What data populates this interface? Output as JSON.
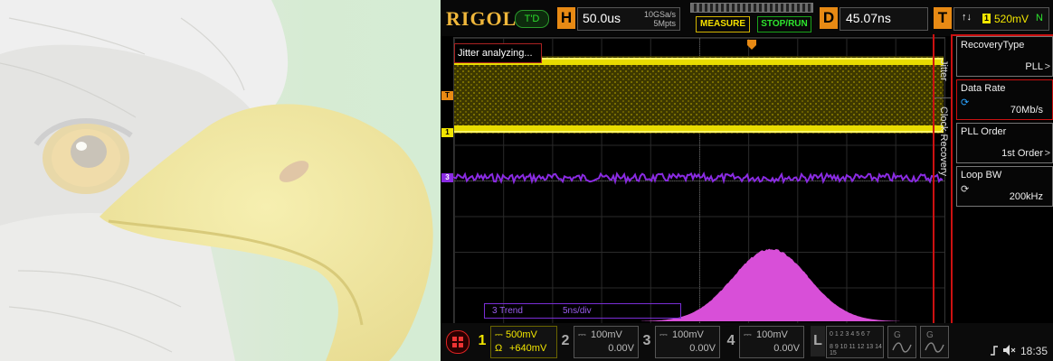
{
  "brand": "RIGOL",
  "mode_badge": "T'D",
  "timebase": {
    "letter": "H",
    "value": "50.0us",
    "sample_rate": "10GSa/s",
    "memory": "5Mpts"
  },
  "buttons": {
    "measure": "MEASURE",
    "stop_run": "STOP/RUN"
  },
  "delay": {
    "letter": "D",
    "value": "45.07ns"
  },
  "trigger": {
    "letter": "T",
    "level": "520mV",
    "mode": "N",
    "slope_icon": "↑↓",
    "source": "1"
  },
  "overlay": {
    "jitter": "Jitter analyzing...",
    "trend_label": "3 Trend",
    "trend_scale": "5ns/div"
  },
  "channels": [
    {
      "num": "1",
      "scale": "500mV",
      "offset": "+640mV",
      "omega": "Ω",
      "color": "#f2e600"
    },
    {
      "num": "2",
      "scale": "100mV",
      "offset": "0.00V",
      "color": "#8a8a8a"
    },
    {
      "num": "3",
      "scale": "100mV",
      "offset": "0.00V",
      "color": "#8a8a8a"
    },
    {
      "num": "4",
      "scale": "100mV",
      "offset": "0.00V",
      "color": "#8a8a8a"
    }
  ],
  "logic": {
    "letter": "L",
    "row1": "0 1 2 3 4 5 6 7",
    "row2": "8 9 10 11 12 13 14 15"
  },
  "side_tabs": {
    "jitter": "Jitter",
    "clock_recovery": "Clock Recovery"
  },
  "menu": [
    {
      "label": "RecoveryType",
      "value": "PLL"
    },
    {
      "label": "Data Rate",
      "value": "70Mb/s"
    },
    {
      "label": "PLL Order",
      "value": "1st Order"
    },
    {
      "label": "Loop BW",
      "value": "200kHz"
    }
  ],
  "status": {
    "time": "18:35"
  },
  "colors": {
    "ch1": "#f2e600",
    "ch3": "#8a2be2",
    "histogram": "#d84fd8",
    "accent_red": "#cc1111",
    "orange": "#e88a14"
  }
}
